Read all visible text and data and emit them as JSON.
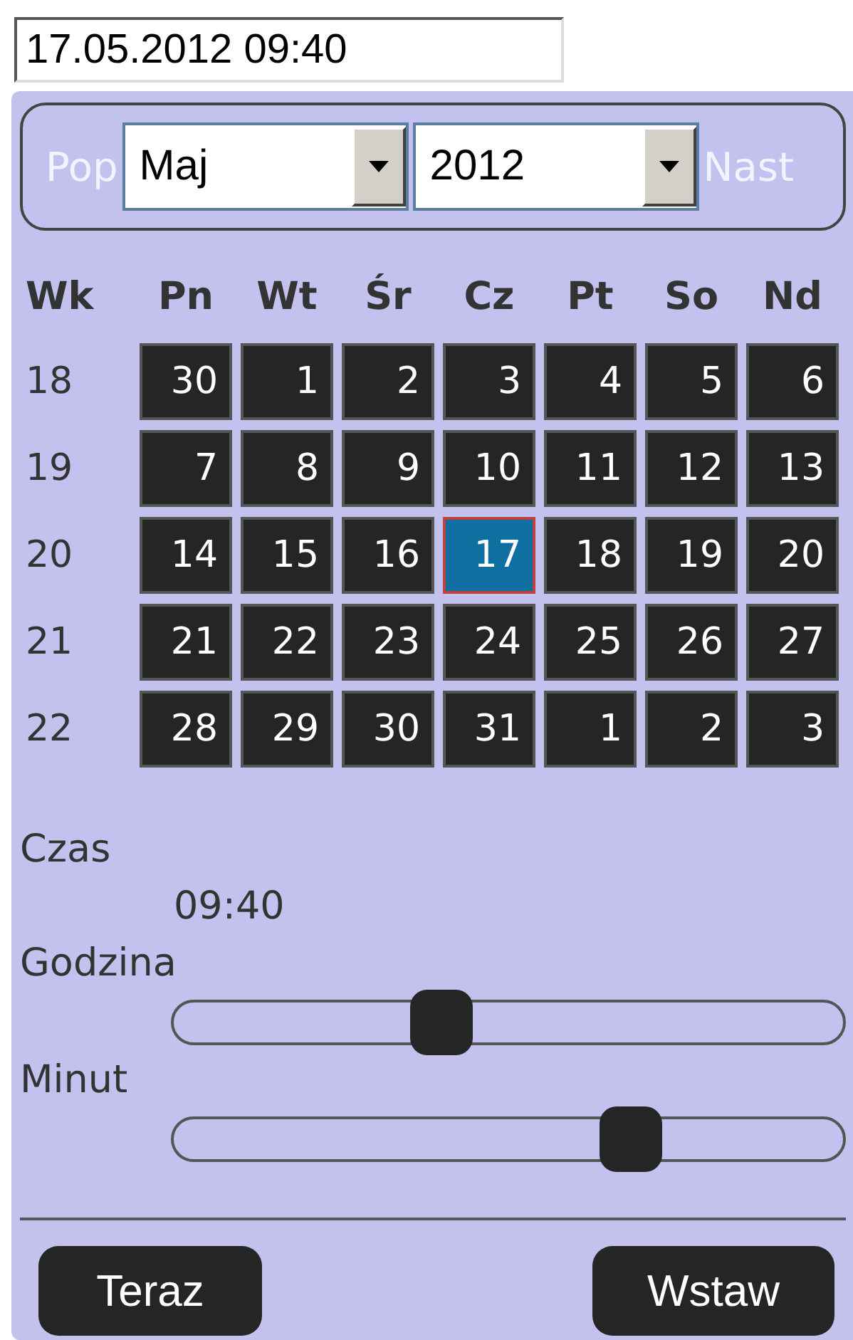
{
  "date_field": {
    "value": "17.05.2012 09:40"
  },
  "nav": {
    "prev": "Pop",
    "month": "Maj",
    "year": "2012",
    "next": "Nast"
  },
  "weekdays": [
    "Wk",
    "Pn",
    "Wt",
    "Śr",
    "Cz",
    "Pt",
    "So",
    "Nd"
  ],
  "weeks": [
    {
      "week": "18",
      "days": [
        {
          "day": "30",
          "selected": false
        },
        {
          "day": "1",
          "selected": false
        },
        {
          "day": "2",
          "selected": false
        },
        {
          "day": "3",
          "selected": false
        },
        {
          "day": "4",
          "selected": false
        },
        {
          "day": "5",
          "selected": false
        },
        {
          "day": "6",
          "selected": false
        }
      ]
    },
    {
      "week": "19",
      "days": [
        {
          "day": "7",
          "selected": false
        },
        {
          "day": "8",
          "selected": false
        },
        {
          "day": "9",
          "selected": false
        },
        {
          "day": "10",
          "selected": false
        },
        {
          "day": "11",
          "selected": false
        },
        {
          "day": "12",
          "selected": false
        },
        {
          "day": "13",
          "selected": false
        }
      ]
    },
    {
      "week": "20",
      "days": [
        {
          "day": "14",
          "selected": false
        },
        {
          "day": "15",
          "selected": false
        },
        {
          "day": "16",
          "selected": false
        },
        {
          "day": "17",
          "selected": true
        },
        {
          "day": "18",
          "selected": false
        },
        {
          "day": "19",
          "selected": false
        },
        {
          "day": "20",
          "selected": false
        }
      ]
    },
    {
      "week": "21",
      "days": [
        {
          "day": "21",
          "selected": false
        },
        {
          "day": "22",
          "selected": false
        },
        {
          "day": "23",
          "selected": false
        },
        {
          "day": "24",
          "selected": false
        },
        {
          "day": "25",
          "selected": false
        },
        {
          "day": "26",
          "selected": false
        },
        {
          "day": "27",
          "selected": false
        }
      ]
    },
    {
      "week": "22",
      "days": [
        {
          "day": "28",
          "selected": false
        },
        {
          "day": "29",
          "selected": false
        },
        {
          "day": "30",
          "selected": false
        },
        {
          "day": "31",
          "selected": false
        },
        {
          "day": "1",
          "selected": false
        },
        {
          "day": "2",
          "selected": false
        },
        {
          "day": "3",
          "selected": false
        }
      ]
    }
  ],
  "time": {
    "label": "Czas",
    "value": "09:40"
  },
  "sliders": [
    {
      "label": "Godzina",
      "level": 0.39
    },
    {
      "label": "Minut",
      "level": 0.7
    }
  ],
  "buttons": [
    "Teraz",
    "Wstaw"
  ]
}
